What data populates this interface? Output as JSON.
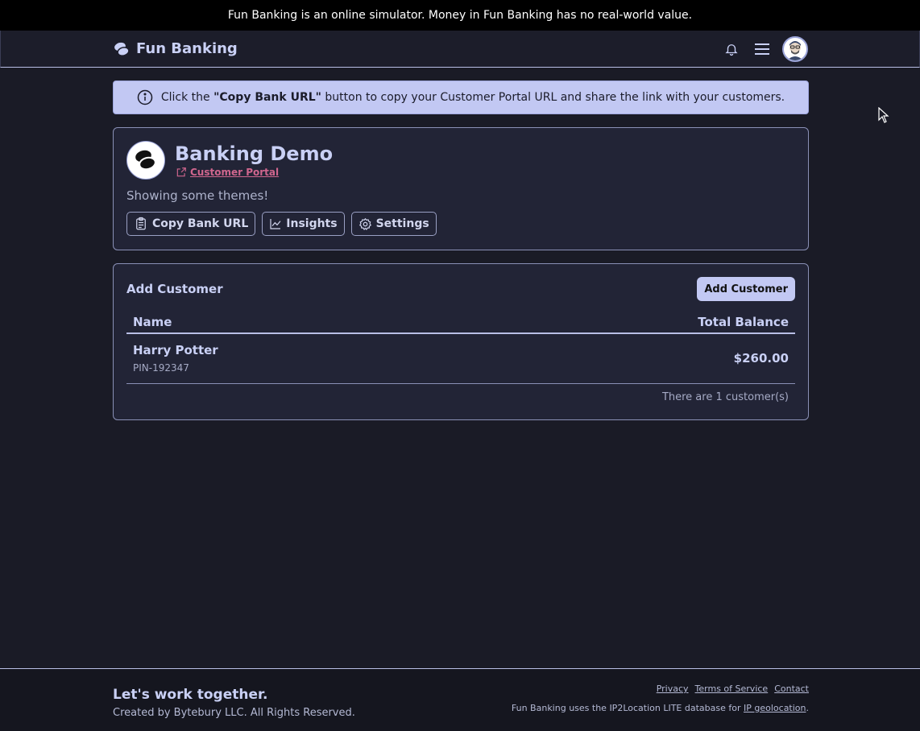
{
  "top_notice": "Fun Banking is an online simulator. Money in Fun Banking has no real-world value.",
  "navbar": {
    "brand": "Fun Banking"
  },
  "info_banner": {
    "prefix": "Click the ",
    "bold": "\"Copy Bank URL\"",
    "suffix": " button to copy your Customer Portal URL and share the link with your customers."
  },
  "bank": {
    "title": "Banking Demo",
    "portal_link": "Customer Portal",
    "description": "Showing some themes!",
    "buttons": {
      "copy": "Copy Bank URL",
      "insights": "Insights",
      "settings": "Settings"
    }
  },
  "customers": {
    "title": "Add Customer",
    "add_button": "Add Customer",
    "columns": {
      "name": "Name",
      "balance": "Total Balance"
    },
    "rows": [
      {
        "name": "Harry Potter",
        "pin": "PIN-192347",
        "balance": "$260.00"
      }
    ],
    "count_text": "There are 1 customer(s)"
  },
  "footer": {
    "title": "Let's work together.",
    "copyright": "Created by Bytebury LLC. All Rights Reserved.",
    "links": {
      "privacy": "Privacy",
      "terms": "Terms of Service",
      "contact": "Contact"
    },
    "note_prefix": "Fun Banking uses the IP2Location LITE database for ",
    "note_link": "IP geolocation",
    "note_suffix": "."
  },
  "colors": {
    "accent": "#c2c8f3",
    "background": "#1a1b26",
    "link": "#d0668e"
  }
}
